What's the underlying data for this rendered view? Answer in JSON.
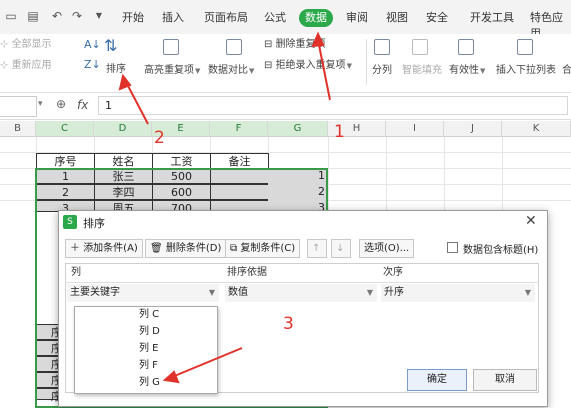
{
  "menu": {
    "tabs": [
      "开始",
      "插入",
      "页面布局",
      "公式",
      "数据",
      "审阅",
      "视图",
      "安全",
      "开发工具",
      "特色应用"
    ],
    "active_tab": "数据"
  },
  "ribbon": {
    "show_all": "全部显示",
    "reapply": "重新应用",
    "sort": "排序",
    "highlight_duplicates": "高亮重复项",
    "remove_duplicates": "删除重复项",
    "reject_duplicates": "拒绝录入重复项",
    "data_compare": "数据对比",
    "split": "分列",
    "smart_fill": "智能填充",
    "validity": "有效性",
    "insert_dropdown": "插入下拉列表",
    "merge_calc": "合"
  },
  "formula_bar": {
    "fx": "fx",
    "value": "1"
  },
  "columns": [
    "B",
    "C",
    "D",
    "E",
    "F",
    "G",
    "H",
    "I",
    "J",
    "K"
  ],
  "table": {
    "headers": [
      "序号",
      "姓名",
      "工资",
      "备注"
    ],
    "rows": [
      {
        "no": "1",
        "name": "张三",
        "salary": "500",
        "g": "1"
      },
      {
        "no": "2",
        "name": "李四",
        "salary": "600",
        "g": "2"
      },
      {
        "no": "3",
        "name": "周五",
        "salary": "700",
        "g": "3"
      }
    ],
    "partial_row_label": "序"
  },
  "dialog": {
    "title": "排序",
    "add_condition": "添加条件(A)",
    "delete_condition": "删除条件(D)",
    "copy_condition": "复制条件(C)",
    "options": "选项(O)...",
    "has_header": "数据包含标题(H)",
    "col_header": "列",
    "basis_header": "排序依据",
    "order_header": "次序",
    "primary_key": "主要关键字",
    "basis_value": "数值",
    "order_value": "升序",
    "ok": "确定",
    "cancel": "取消",
    "dropdown_items": [
      "列 C",
      "列 D",
      "列 E",
      "列 F",
      "列 G"
    ]
  },
  "annotations": {
    "n1": "1",
    "n2": "2",
    "n3": "3"
  },
  "colors": {
    "accent_green": "#2aa84a",
    "annotation_red": "#e0322a",
    "selection_green": "#3a9a4a"
  }
}
